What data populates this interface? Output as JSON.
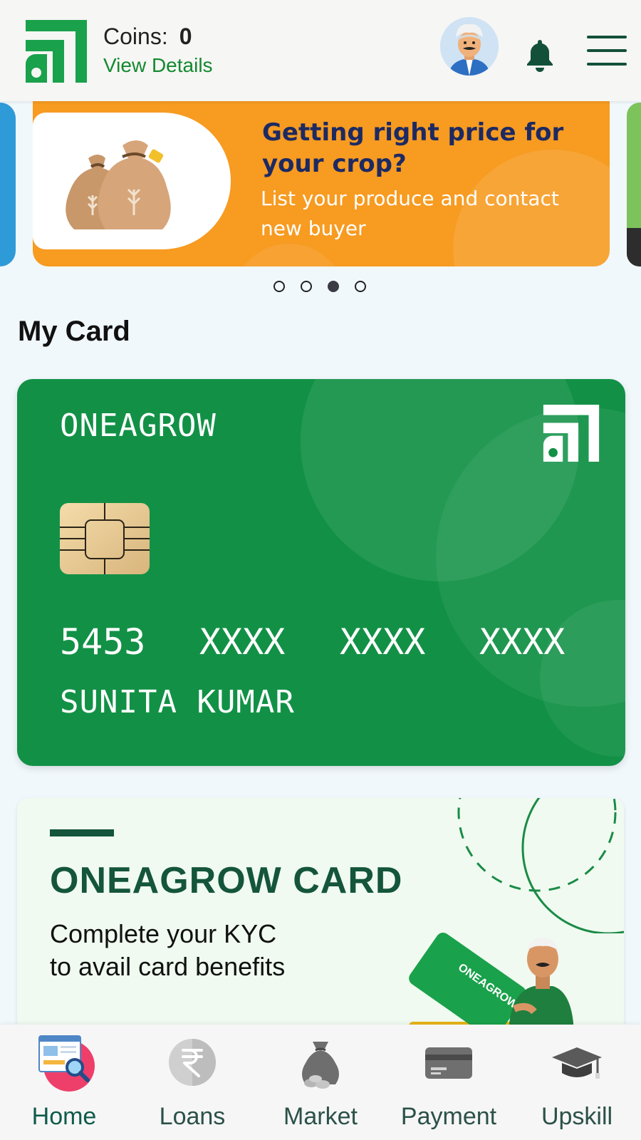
{
  "header": {
    "coins_label": "Coins:",
    "coins_value": "0",
    "view_details": "View Details"
  },
  "banner": {
    "title": "Getting right price for your crop?",
    "subtitle": "List your produce and contact new buyer",
    "slides_count": 4,
    "active_slide": 3
  },
  "my_card": {
    "section_title": "My Card",
    "brand": "ONEAGROW",
    "number_groups": [
      "5453",
      "XXXX",
      "XXXX",
      "XXXX"
    ],
    "holder_name": "SUNITA KUMAR"
  },
  "promo": {
    "title": "ONEAGROW CARD",
    "line1": "Complete your KYC",
    "line2": "to avail card benefits",
    "card_art_text": "ONEAGROW"
  },
  "bottom_nav": {
    "items": [
      {
        "label": "Home",
        "icon": "home-icon",
        "active": true
      },
      {
        "label": "Loans",
        "icon": "rupee-icon",
        "active": false
      },
      {
        "label": "Market",
        "icon": "money-bag-icon",
        "active": false
      },
      {
        "label": "Payment",
        "icon": "credit-card-icon",
        "active": false
      },
      {
        "label": "Upskill",
        "icon": "graduation-cap-icon",
        "active": false
      }
    ]
  },
  "colors": {
    "brand_green": "#129146",
    "dark_green": "#14553c",
    "banner_orange": "#f79b21",
    "banner_title": "#1d2a62"
  }
}
